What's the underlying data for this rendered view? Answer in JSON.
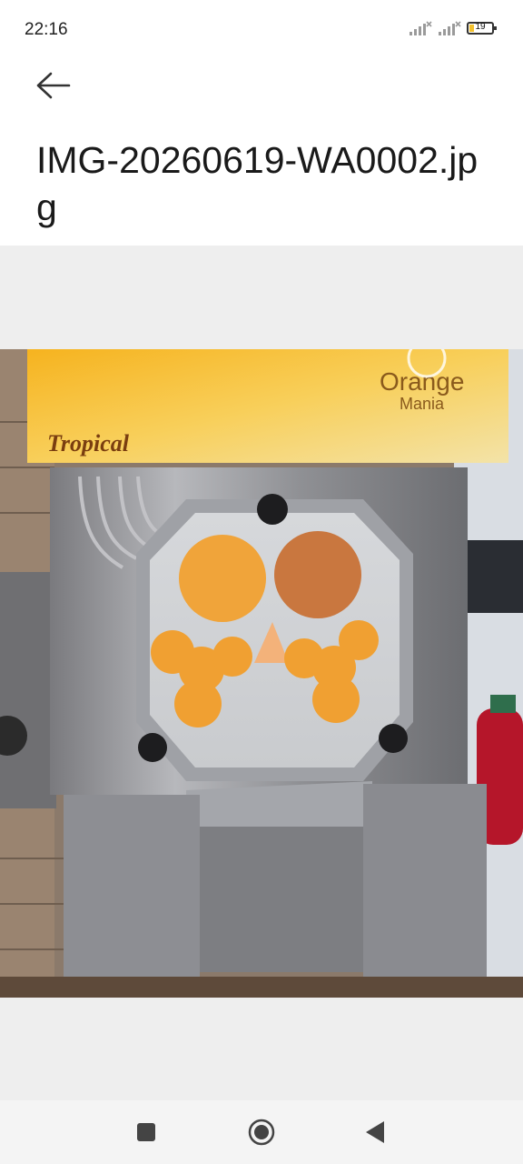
{
  "status_bar": {
    "time": "22:16",
    "battery_level": "19",
    "icons": [
      "signal-icon",
      "signal-icon",
      "battery-icon"
    ]
  },
  "app_bar": {
    "back_icon": "arrow-left-icon",
    "title": "IMG-20260619-WA0002.jpg"
  },
  "image": {
    "sign_text": "Tropical",
    "brand_line1": "Orange",
    "brand_line2": "Mania"
  },
  "nav_bar": {
    "icons": [
      "square-recents-icon",
      "circle-home-icon",
      "triangle-back-icon"
    ]
  },
  "colors": {
    "viewer_background": "#eeeeee",
    "nav_background": "#f4f4f4",
    "battery_fill": "#f2c12e"
  }
}
